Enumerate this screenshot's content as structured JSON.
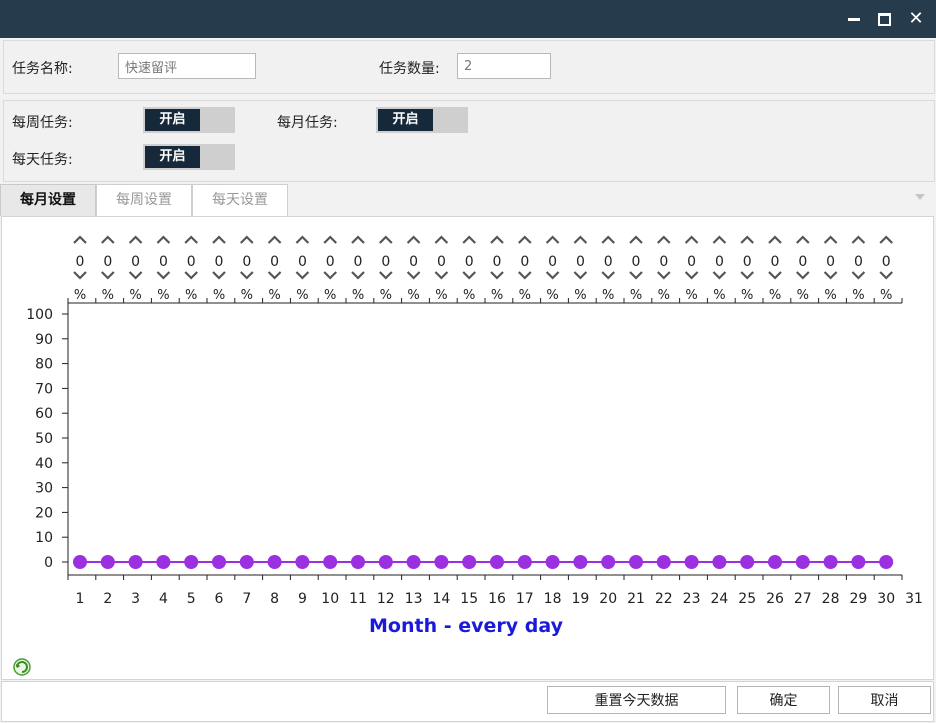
{
  "form": {
    "task_name_label": "任务名称:",
    "task_name_value": "快速留评",
    "task_count_label": "任务数量:",
    "task_count_value": "2"
  },
  "switches": {
    "weekly_label": "每周任务:",
    "weekly_state": "开启",
    "monthly_label": "每月任务:",
    "monthly_state": "开启",
    "daily_label": "每天任务:",
    "daily_state": "开启"
  },
  "tabs": [
    {
      "label": "每月设置",
      "active": true
    },
    {
      "label": "每周设置",
      "active": false
    },
    {
      "label": "每天设置",
      "active": false
    }
  ],
  "buttons": {
    "reset_today": "重置今天数据",
    "ok": "确定",
    "cancel": "取消"
  },
  "colors": {
    "titlebar": "#263b4c",
    "toggle_on": "#16293a",
    "point": "#9b30e0",
    "xlabel": "#1a1adb"
  },
  "chart_data": {
    "type": "line",
    "title": "",
    "xlabel": "Month - every day",
    "ylabel": "",
    "x": [
      1,
      2,
      3,
      4,
      5,
      6,
      7,
      8,
      9,
      10,
      11,
      12,
      13,
      14,
      15,
      16,
      17,
      18,
      19,
      20,
      21,
      22,
      23,
      24,
      25,
      26,
      27,
      28,
      29,
      30,
      31
    ],
    "ylim": [
      0,
      100
    ],
    "yticks": [
      0,
      10,
      20,
      30,
      40,
      50,
      60,
      70,
      80,
      90,
      100
    ],
    "values": [
      0,
      0,
      0,
      0,
      0,
      0,
      0,
      0,
      0,
      0,
      0,
      0,
      0,
      0,
      0,
      0,
      0,
      0,
      0,
      0,
      0,
      0,
      0,
      0,
      0,
      0,
      0,
      0,
      0,
      0
    ],
    "point_labels": [
      "0",
      "0",
      "0",
      "0",
      "0",
      "0",
      "0",
      "0",
      "0",
      "0",
      "0",
      "0",
      "0",
      "0",
      "0",
      "0",
      "0",
      "0",
      "0",
      "0",
      "0",
      "0",
      "0",
      "0",
      "0",
      "0",
      "0",
      "0",
      "0",
      "0"
    ],
    "unit": "%",
    "grid": false,
    "legend": "none"
  }
}
